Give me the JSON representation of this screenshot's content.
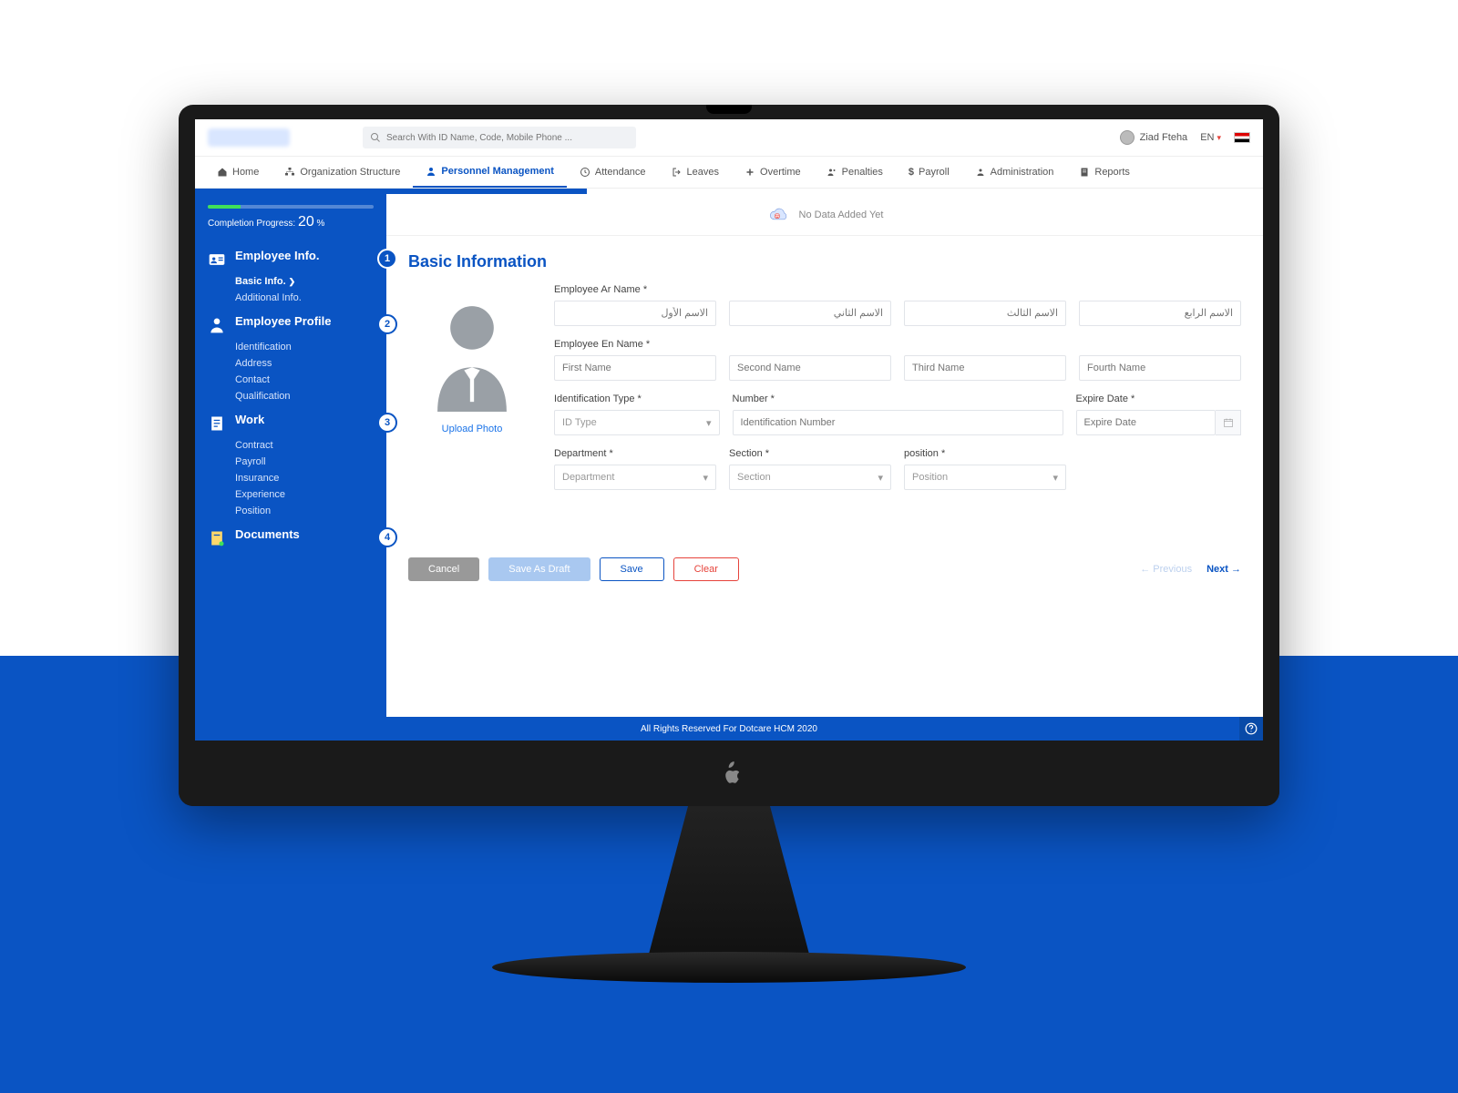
{
  "topbar": {
    "search_placeholder": "Search With ID Name, Code, Mobile Phone ...",
    "username": "Ziad Fteha",
    "lang": "EN"
  },
  "nav": {
    "home": "Home",
    "org": "Organization Structure",
    "personnel": "Personnel Management",
    "attendance": "Attendance",
    "leaves": "Leaves",
    "overtime": "Overtime",
    "penalties": "Penalties",
    "payroll": "Payroll",
    "admin": "Administration",
    "reports": "Reports"
  },
  "progress": {
    "label": "Completion Progress:",
    "pct": "20",
    "suffix": "%"
  },
  "sidebar": {
    "s1": {
      "title": "Employee Info.",
      "num": "1",
      "basic": "Basic Info.",
      "additional": "Additional Info."
    },
    "s2": {
      "title": "Employee Profile",
      "num": "2",
      "identification": "Identification",
      "address": "Address",
      "contact": "Contact",
      "qualification": "Qualification"
    },
    "s3": {
      "title": "Work",
      "num": "3",
      "contract": "Contract",
      "payroll": "Payroll",
      "insurance": "Insurance",
      "experience": "Experience",
      "position": "Position"
    },
    "s4": {
      "title": "Documents",
      "num": "4"
    }
  },
  "main": {
    "nodata": "No Data Added Yet",
    "title": "Basic Information",
    "upload": "Upload Photo",
    "labels": {
      "ar_name": "Employee Ar Name *",
      "en_name": "Employee En Name *",
      "id_type": "Identification Type *",
      "number": "Number *",
      "expire": "Expire Date *",
      "dept": "Department *",
      "section": "Section *",
      "position": "position *"
    },
    "ph": {
      "ar1": "الاسم الأول",
      "ar2": "الاسم الثاني",
      "ar3": "الاسم الثالث",
      "ar4": "الاسم الرابع",
      "en1": "First Name",
      "en2": "Second Name",
      "en3": "Third Name",
      "en4": "Fourth Name",
      "id_type": "ID Type",
      "id_num": "Identification Number",
      "expire": "Expire Date",
      "dept": "Department",
      "section": "Section",
      "position": "Position"
    }
  },
  "buttons": {
    "cancel": "Cancel",
    "draft": "Save As Draft",
    "save": "Save",
    "clear": "Clear",
    "prev": "Previous",
    "next": "Next"
  },
  "footer": "All Rights Reserved For Dotcare HCM 2020"
}
